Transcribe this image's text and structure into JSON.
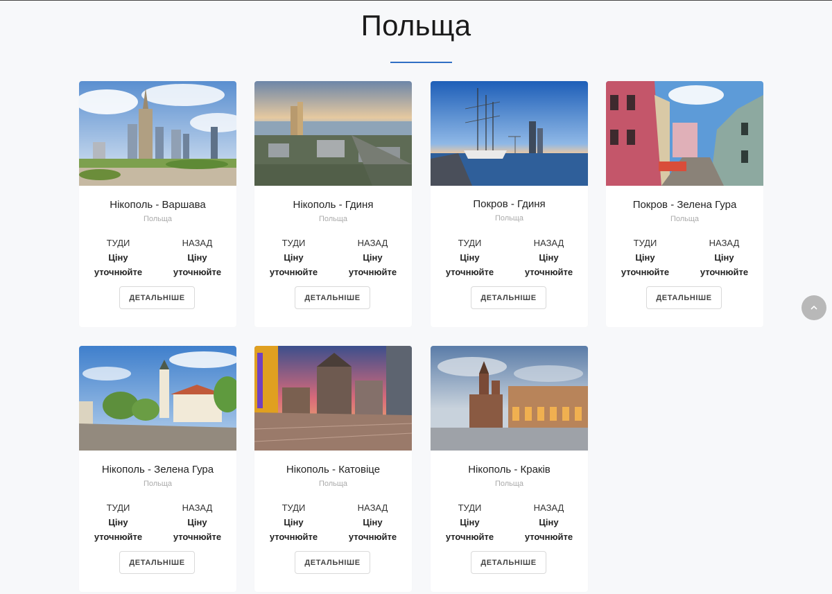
{
  "page": {
    "title": "Польща",
    "accent_color": "#2f6fc4"
  },
  "cards": [
    {
      "title": "Нікополь - Варшава",
      "country": "Польща",
      "there_label": "ТУДИ",
      "there_value": "Ціну уточнюйте",
      "back_label": "НАЗАД",
      "back_value": "Ціну уточнюйте",
      "button": "ДЕТАЛЬНІШЕ",
      "image": "warsaw-skyline"
    },
    {
      "title": "Нікополь - Гдиня",
      "country": "Польща",
      "there_label": "ТУДИ",
      "there_value": "Ціну уточнюйте",
      "back_label": "НАЗАД",
      "back_value": "Ціну уточнюйте",
      "button": "ДЕТАЛЬНІШЕ",
      "image": "gdynia-aerial"
    },
    {
      "title": "Покров - Гдиня",
      "country": "Польща",
      "there_label": "ТУДИ",
      "there_value": "Ціну уточнюйте",
      "back_label": "НАЗАД",
      "back_value": "Ціну уточнюйте",
      "button": "ДЕТАЛЬНІШЕ",
      "image": "gdynia-sailship"
    },
    {
      "title": "Покров - Зелена Гура",
      "country": "Польща",
      "there_label": "ТУДИ",
      "there_value": "Ціну уточнюйте",
      "back_label": "НАЗАД",
      "back_value": "Ціну уточнюйте",
      "button": "ДЕТАЛЬНІШЕ",
      "image": "zielona-gora-street"
    },
    {
      "title": "Нікополь - Зелена Гура",
      "country": "Польща",
      "there_label": "ТУДИ",
      "there_value": "Ціну уточнюйте",
      "back_label": "НАЗАД",
      "back_value": "Ціну уточнюйте",
      "button": "ДЕТАЛЬНІШЕ",
      "image": "zielona-gora-square"
    },
    {
      "title": "Нікополь - Катовіце",
      "country": "Польща",
      "there_label": "ТУДИ",
      "there_value": "Ціну уточнюйте",
      "back_label": "НАЗАД",
      "back_value": "Ціну уточнюйте",
      "button": "ДЕТАЛЬНІШЕ",
      "image": "katowice-street"
    },
    {
      "title": "Нікополь - Краків",
      "country": "Польща",
      "there_label": "ТУДИ",
      "there_value": "Ціну уточнюйте",
      "back_label": "НАЗАД",
      "back_value": "Ціну уточнюйте",
      "button": "ДЕТАЛЬНІШЕ",
      "image": "krakow-square"
    }
  ],
  "scroll_top": {
    "icon": "chevron-up-icon"
  }
}
